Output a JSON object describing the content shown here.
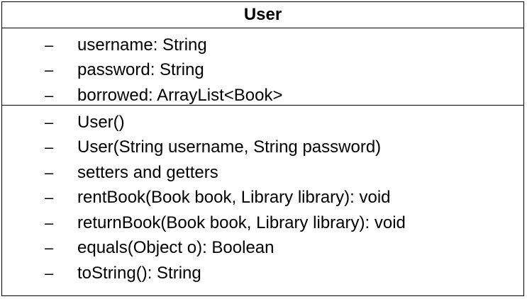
{
  "class": {
    "name": "User",
    "attributes": [
      {
        "visibility": "–",
        "text": "username: String"
      },
      {
        "visibility": "–",
        "text": "password: String"
      },
      {
        "visibility": "–",
        "text": "borrowed: ArrayList<Book>"
      }
    ],
    "methods": [
      {
        "visibility": "–",
        "text": "User()"
      },
      {
        "visibility": "–",
        "text": "User(String username, String password)"
      },
      {
        "visibility": "–",
        "text": "setters and getters"
      },
      {
        "visibility": "–",
        "text": "rentBook(Book book, Library library): void"
      },
      {
        "visibility": "–",
        "text": "returnBook(Book book, Library library): void"
      },
      {
        "visibility": "–",
        "text": "equals(Object o): Boolean"
      },
      {
        "visibility": "–",
        "text": "toString(): String"
      }
    ]
  }
}
